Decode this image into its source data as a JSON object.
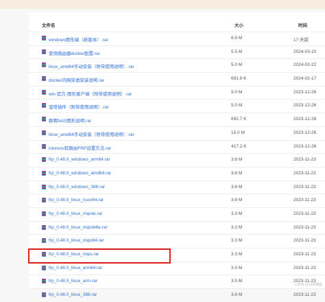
{
  "header": {
    "name": "文件名",
    "size": "大小",
    "time": "时间"
  },
  "files": [
    {
      "name": "windows图形端（新版本）.rar",
      "size": "6.9 M",
      "time": "17 天前"
    },
    {
      "name": "爱快路由器docker配置.rar",
      "size": "5.5 M",
      "time": "2024-03-10"
    },
    {
      "name": "linux_amd64手动安装（附带使用说明）.rar",
      "size": "5.0 M",
      "time": "2024-02-22"
    },
    {
      "name": "docker内网穿透安装说明.rar",
      "size": "691.8 K",
      "time": "2024-02-17"
    },
    {
      "name": "win-官方-图形客户端（附带使用说明）.rar",
      "size": "9.0 M",
      "time": "2023-12-26"
    },
    {
      "name": "宝塔插件（附带使用说明）.rar",
      "size": "5.0 M",
      "time": "2023-12-26"
    },
    {
      "name": "群晖NAS图形说明.rar",
      "size": "692.7 K",
      "time": "2023-12-26"
    },
    {
      "name": "linux_amd64手动安装（附带使用说明）.rar",
      "size": "15.0 M",
      "time": "2023-12-26"
    },
    {
      "name": "istoreos软路由FRP设置方法.rar",
      "size": "417.2 K",
      "time": "2023-12-26"
    },
    {
      "name": "frp_0.48.0_windows_arm64.rar",
      "size": "3.6 M",
      "time": "2023-11-23"
    },
    {
      "name": "frp_0.48.0_windows_amd64.rar",
      "size": "3.6 M",
      "time": "2023-11-23"
    },
    {
      "name": "frp_0.48.0_windows_386.rar",
      "size": "3.6 M",
      "time": "2023-11-23"
    },
    {
      "name": "frp_0.48.0_linux_riscv64.rar",
      "size": "3.6 M",
      "time": "2023-11-23"
    },
    {
      "name": "frp_0.48.0_linux_mipsle.rar",
      "size": "3.3 M",
      "time": "2023-11-23"
    },
    {
      "name": "frp_0.48.0_linux_mips64le.rar",
      "size": "3.3 M",
      "time": "2023-11-23"
    },
    {
      "name": "frp_0.48.0_linux_mips64.rar",
      "size": "3.3 M",
      "time": "2023-11-23"
    },
    {
      "name": "frp_0.48.0_linux_mips.rar",
      "size": "3.3 M",
      "time": "2023-11-23"
    },
    {
      "name": "frp_0.48.0_linux_arm64.rar",
      "size": "3.5 M",
      "time": "2023-11-23"
    },
    {
      "name": "frp_0.48.0_linux_arm.rar",
      "size": "3.5 M",
      "time": "2023-11-23"
    },
    {
      "name": "frp_0.48.0_linux_386.rar",
      "size": "3.6 M",
      "time": "2023-11-23"
    }
  ],
  "watermark": "CSDN @清风拂面",
  "icon": "archive-file-icon",
  "colors": {
    "link": "#2a6ed6",
    "highlight": "#e0201a"
  }
}
